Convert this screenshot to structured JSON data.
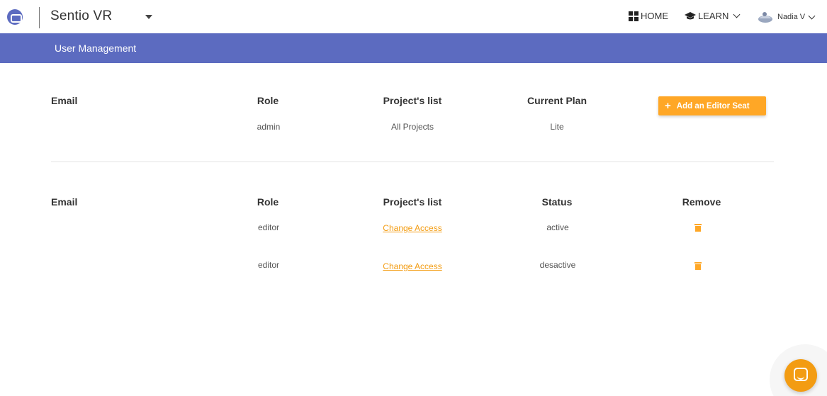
{
  "topbar": {
    "app_name": "Sentio VR",
    "nav_home": "HOME",
    "nav_learn": "LEARN",
    "user_name": "Nadia V"
  },
  "header": {
    "title": "User Management"
  },
  "plan_table": {
    "headers": [
      "Email",
      "Role",
      "Project's list",
      "Current Plan"
    ],
    "row": {
      "email": "",
      "role": "admin",
      "projects": "All Projects",
      "plan": "Lite"
    },
    "add_button_label": "Add an Editor Seat"
  },
  "editors_table": {
    "headers": [
      "Email",
      "Role",
      "Project's list",
      "Status",
      "Remove"
    ],
    "rows": [
      {
        "email": "",
        "role": "editor",
        "projects_link": "Change Access",
        "status": "active"
      },
      {
        "email": "",
        "role": "editor",
        "projects_link": "Change Access",
        "status": "desactive"
      }
    ]
  },
  "colors": {
    "accent": "#5c6bc0",
    "action": "#ffa726",
    "link": "#f39c12"
  },
  "icons": {
    "logo": "app-logo-icon",
    "home": "grid-icon",
    "learn": "graduation-cap-icon",
    "remove": "trash-icon",
    "chat": "chat-icon"
  }
}
